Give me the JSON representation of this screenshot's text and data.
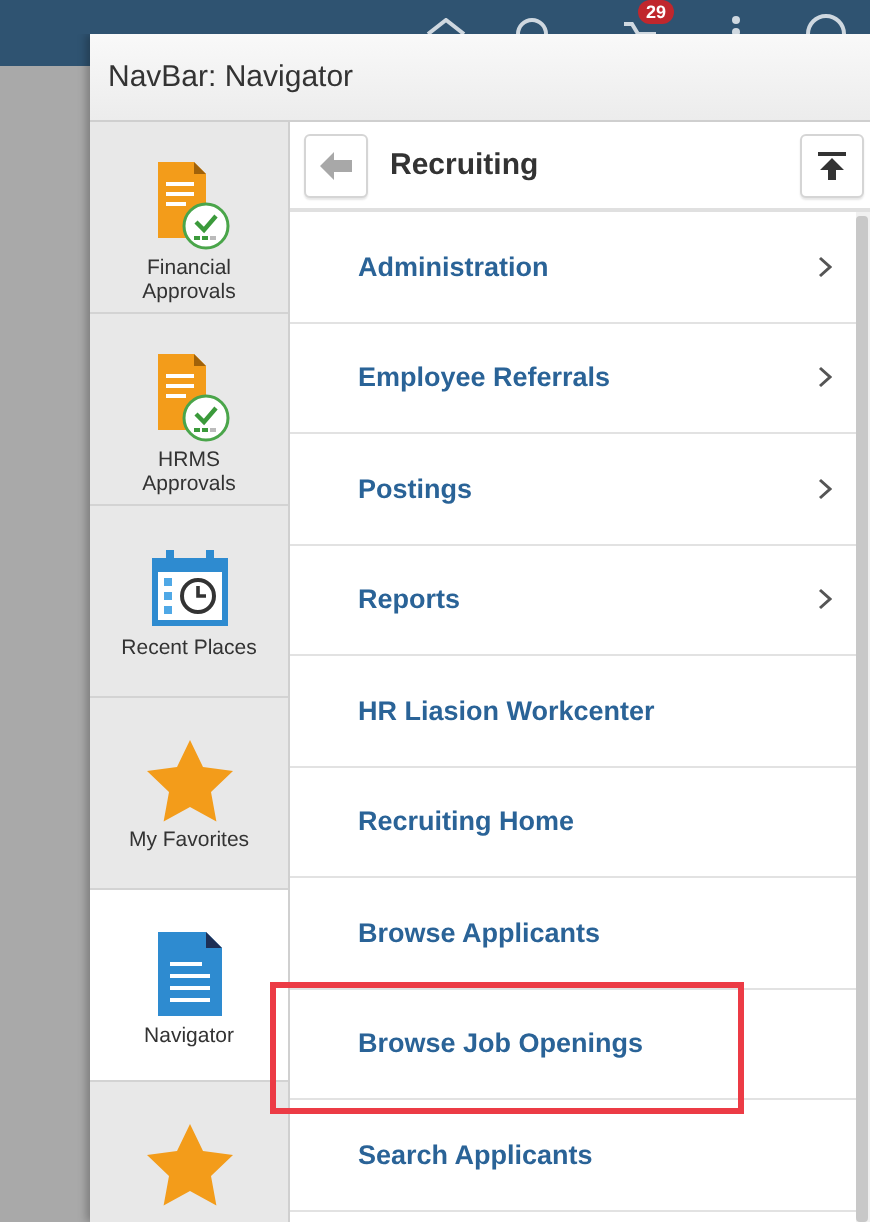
{
  "top_bar": {
    "badge": "29"
  },
  "dialog": {
    "title": "NavBar: Navigator"
  },
  "sidebar": {
    "items": [
      {
        "label": "Financial Approvals",
        "kind": "approval",
        "selected": false
      },
      {
        "label": "HRMS Approvals",
        "kind": "approval",
        "selected": false
      },
      {
        "label": "Recent Places",
        "kind": "recent",
        "selected": false
      },
      {
        "label": "My Favorites",
        "kind": "favorite",
        "selected": false
      },
      {
        "label": "Navigator",
        "kind": "navigator",
        "selected": true
      },
      {
        "kind": "favorite",
        "selected": false
      }
    ]
  },
  "folder": {
    "title": "Recruiting",
    "items": [
      {
        "label": "Administration",
        "has_children": true,
        "highlighted": false
      },
      {
        "label": "Employee Referrals",
        "has_children": true,
        "highlighted": false
      },
      {
        "label": "Postings",
        "has_children": true,
        "highlighted": false
      },
      {
        "label": "Reports",
        "has_children": true,
        "highlighted": false
      },
      {
        "label": "HR Liasion Workcenter",
        "has_children": false,
        "highlighted": false
      },
      {
        "label": "Recruiting Home",
        "has_children": false,
        "highlighted": false
      },
      {
        "label": "Browse Applicants",
        "has_children": false,
        "highlighted": false
      },
      {
        "label": "Browse Job Openings",
        "has_children": false,
        "highlighted": true
      },
      {
        "label": "Search Applicants",
        "has_children": false,
        "highlighted": false
      }
    ]
  }
}
